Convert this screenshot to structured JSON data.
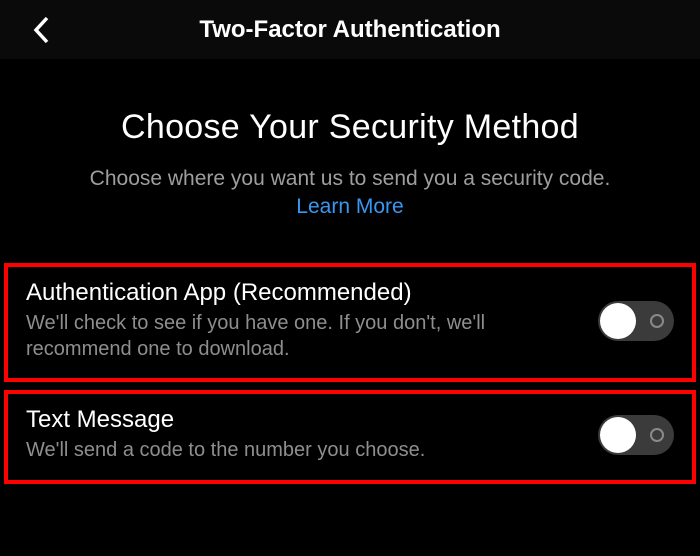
{
  "header": {
    "title": "Two-Factor Authentication"
  },
  "intro": {
    "heading": "Choose Your Security Method",
    "subtitle": "Choose where you want us to send you a security code.",
    "learn_more": "Learn More"
  },
  "options": [
    {
      "title": "Authentication App (Recommended)",
      "desc": "We'll check to see if you have one. If you don't, we'll recommend one to download.",
      "toggle_on": false
    },
    {
      "title": "Text Message",
      "desc": "We'll send a code to the number you choose.",
      "toggle_on": false
    }
  ],
  "colors": {
    "link": "#3897f0",
    "highlight_border": "#ff0000"
  }
}
